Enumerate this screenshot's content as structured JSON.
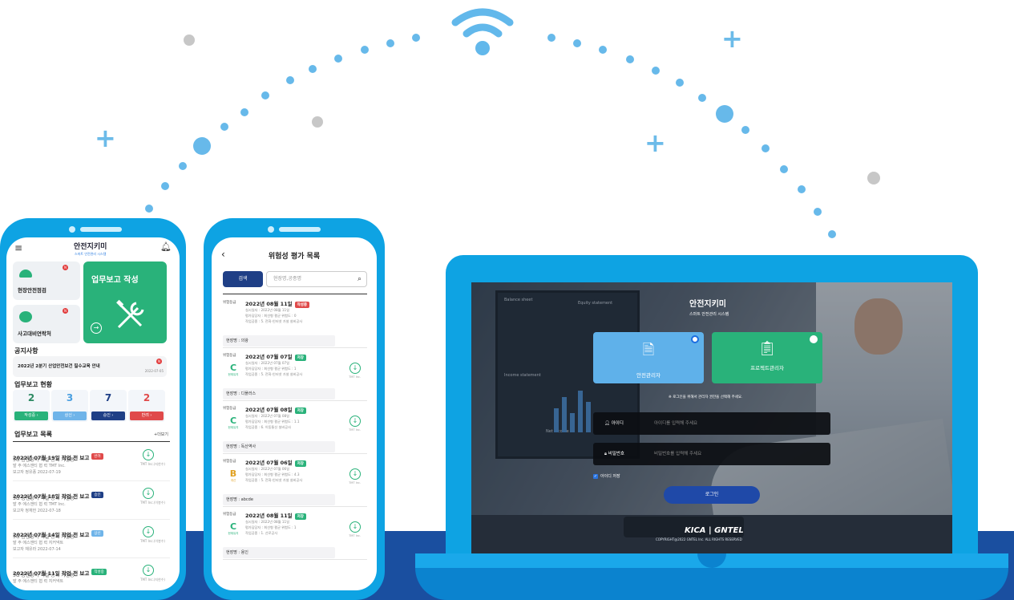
{
  "phone1": {
    "app_name": "안전지키미",
    "app_sub": "스마트 안전관리 시스템",
    "quick": [
      {
        "label": "현장안전점검"
      },
      {
        "label": "사고대비연락처"
      }
    ],
    "big_card": {
      "label": "업무보고 작성",
      "arrow": "→"
    },
    "notice_title": "공지사항",
    "notice": {
      "text": "2022년 2분기 산업안전보건 필수교육 안내",
      "date": "2022-07-05",
      "badge": "N"
    },
    "status_title": "업무보고 현황",
    "stats": [
      {
        "value": "2",
        "label": "작성중 ›",
        "color": "#29b27a",
        "text_color": "#2d8a63"
      },
      {
        "value": "3",
        "label": "상신 ›",
        "color": "#6fb4e9",
        "text_color": "#4a9fe0"
      },
      {
        "value": "7",
        "label": "승인 ›",
        "color": "#1f3f86",
        "text_color": "#1f3f86"
      },
      {
        "value": "2",
        "label": "반려 ›",
        "color": "#e04a4a",
        "text_color": "#e04a4a"
      }
    ],
    "list_title": "업무보고 목록",
    "more": "+더보기",
    "reports": [
      {
        "title": "2022년 07월 19일 작업 전 보고",
        "badge": "반려",
        "badge_color": "#e04a4a",
        "l1": "5G 통신장비 이설 공사 가산동",
        "l2": "발 주 에스앤티   협 력 TMT Inc.",
        "l3": "보고자 정유풍   2022-07-19",
        "co": "TMT Inc.(지한수)"
      },
      {
        "title": "2022년 07월 18일 작업 전 보고",
        "badge": "승인",
        "badge_color": "#1f3f86",
        "l1": "5G 통신장비 이설 공사 가산동",
        "l2": "발 주 에스앤티   협 력 TMT Inc.",
        "l3": "보고자 정재헌   2022-07-18",
        "co": "TMT Inc.(이봉수)"
      },
      {
        "title": "2022년 07월 14일 작업 전 보고",
        "badge": "상신",
        "badge_color": "#6fb4e9",
        "l1": "5G 통신장비 이설 공사 가산동",
        "l2": "발 주 에스앤티   협 력 지커넥트",
        "l3": "보고자 채유라   2022-07-14",
        "co": "TMT Inc.(이봉수)"
      },
      {
        "title": "2022년 07월 11일 작업 전 보고",
        "badge": "작성중",
        "badge_color": "#29b27a",
        "l1": "5G 통신장비 이설 공사 가산동",
        "l2": "발 주 에스앤티   협 력 지커넥트",
        "l3": "",
        "co": "TMT Inc.(지한수)"
      }
    ]
  },
  "phone2": {
    "title": "위험성 평가 목록",
    "search_btn": "검색",
    "search_placeholder": "현장명,공종명",
    "items": [
      {
        "label": "위험등급",
        "date": "2022년 08월 11일",
        "badge": "작성중",
        "badge_color": "#e04a4a",
        "grade": "",
        "grade_sub": "",
        "grade_color": "#29b27a",
        "l1": "실시일자 : 2022년 08월 11일",
        "l2": "평가담당자 : 최선형   평균 위험도 : 0",
        "l3": "작업공종 : 5. 전화·인터넷 가설 설비공사",
        "site": "현장명 : 의왕",
        "dl": false
      },
      {
        "label": "위험등급",
        "date": "2022년 07월 07일",
        "badge": "저장",
        "badge_color": "#29b27a",
        "grade": "C",
        "grade_sub": "현재유지",
        "grade_color": "#29b27a",
        "l1": "실시일자 : 2022년 07월 07일",
        "l2": "평가담당자 : 최선형   평균 위험도 : 1",
        "l3": "작업공종 : 5. 전화·인터넷 가설 설비공사",
        "site": "현장명 : 디플러스",
        "dl": true,
        "co": "TMT Inc."
      },
      {
        "label": "위험등급",
        "date": "2022년 07월 08일",
        "badge": "저장",
        "badge_color": "#29b27a",
        "grade": "C",
        "grade_sub": "현재유지",
        "grade_color": "#29b27a",
        "l1": "실시일자 : 2022년 07월 08일",
        "l2": "평가담당자 : 최선형   평균 위험도 : 1.1",
        "l3": "작업공종 : 6. 이동통신 설비공사",
        "site": "현장명 : 독산역사",
        "dl": true,
        "co": "TMT Inc."
      },
      {
        "label": "위험등급",
        "date": "2022년 07월 06일",
        "badge": "저장",
        "badge_color": "#29b27a",
        "grade": "B",
        "grade_sub": "개선",
        "grade_color": "#e0a020",
        "l1": "실시일자 : 2022년 07월 06일",
        "l2": "평가담당자 : 최선형   평균 위험도 : 4.3",
        "l3": "작업공종 : 5. 전화·인터넷 가설 설비공사",
        "site": "현장명 : abcde",
        "dl": true,
        "co": "TMT Inc."
      },
      {
        "label": "위험등급",
        "date": "2022년 08월 11일",
        "badge": "저장",
        "badge_color": "#29b27a",
        "grade": "C",
        "grade_sub": "현재유지",
        "grade_color": "#29b27a",
        "l1": "실시일자 : 2022년 08월 11일",
        "l2": "평가담당자 : 최선형   평균 위험도 : 1",
        "l3": "작업공종 : 1. 선로공사",
        "site": "현장명 : 용인",
        "dl": true,
        "co": "TMT Inc."
      }
    ]
  },
  "laptop": {
    "app_name": "안전지키미",
    "app_sub": "스마트 안전관리 시스템",
    "roles": [
      {
        "label": "안전관리자",
        "color": "#5fb1ea"
      },
      {
        "label": "프로젝트관리자",
        "color": "#29b27a"
      }
    ],
    "hint": "※ 로그인을 위해서 관리자 권한을 선택해 주세요.",
    "id_label": "아이디",
    "id_placeholder": "아이디를 입력해 주세요",
    "pw_label": "비밀번호",
    "pw_placeholder": "비밀번호를 입력해 주세요",
    "remember": "아이디 저장",
    "login": "로그인",
    "brand": "KICA | GNTEL",
    "copyright": "COPYRIGHT@2022 GNTEL Inc. ALL RIGHTS RESERVED",
    "bg_sheet": {
      "t1": "Balance sheet",
      "t2": "Equity statement",
      "t3": "Income statement",
      "t4": "Net income"
    }
  }
}
